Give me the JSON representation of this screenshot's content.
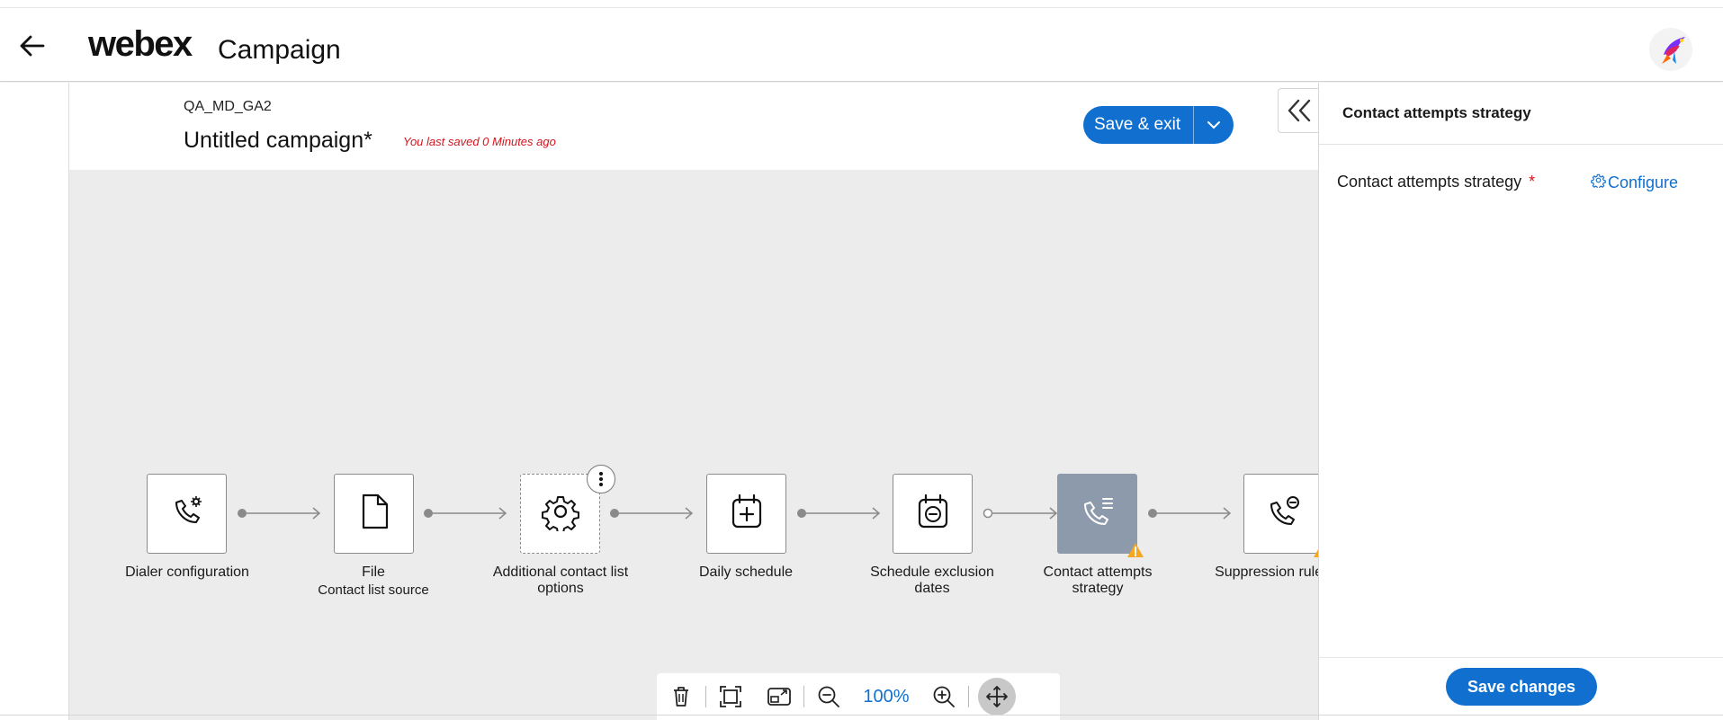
{
  "header": {
    "logo": "webex",
    "app_title": "Campaign"
  },
  "campaign": {
    "id": "QA_MD_GA2",
    "name": "Untitled campaign*",
    "saved_note": "You last saved 0 Minutes ago",
    "save_exit_label": "Save & exit"
  },
  "flow": {
    "nodes": [
      {
        "label": "Dialer configuration",
        "icon": "phone-settings-icon"
      },
      {
        "label": "File",
        "sublabel": "Contact list source",
        "icon": "file-icon"
      },
      {
        "label": "Additional contact list options",
        "icon": "gear-icon"
      },
      {
        "label": "Daily schedule",
        "icon": "calendar-add-icon"
      },
      {
        "label": "Schedule exclusion dates",
        "icon": "calendar-minus-icon"
      },
      {
        "label": "Contact attempts strategy",
        "icon": "phone-list-icon",
        "selected": true,
        "warning": true
      },
      {
        "label": "Suppression rule sets",
        "icon": "phone-minus-icon",
        "warning": true
      }
    ]
  },
  "toolbar": {
    "zoom": "100%",
    "icons": [
      "trash-icon",
      "fit-screen-icon",
      "minimap-icon",
      "zoom-out-icon",
      "zoom-in-icon",
      "pan-icon"
    ]
  },
  "panel": {
    "title": "Contact attempts strategy",
    "field_label": "Contact attempts strategy",
    "required_mark": "*",
    "configure_label": "Configure",
    "save_label": "Save changes"
  },
  "colors": {
    "accent": "#1170cf",
    "selected_node": "#8d9aab",
    "canvas": "#ececec",
    "warning": "#f5a623",
    "error_text": "#d4141c"
  }
}
